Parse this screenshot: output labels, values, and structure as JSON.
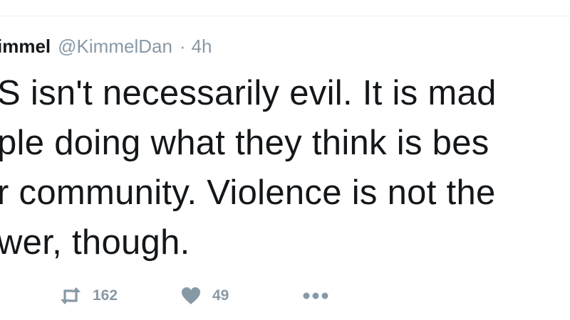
{
  "tweet": {
    "author": {
      "display_name": "immel",
      "handle": "@KimmelDan"
    },
    "separator": "·",
    "timestamp": "4h",
    "text_lines": [
      "S isn't necessarily evil. It is mad",
      "ple doing what they think is bes",
      "r community. Violence is not the",
      "wer, though."
    ],
    "actions": {
      "retweet_count": "162",
      "like_count": "49"
    }
  },
  "colors": {
    "text": "#14171a",
    "muted": "#8899a6",
    "divider": "#e6ecf0"
  }
}
